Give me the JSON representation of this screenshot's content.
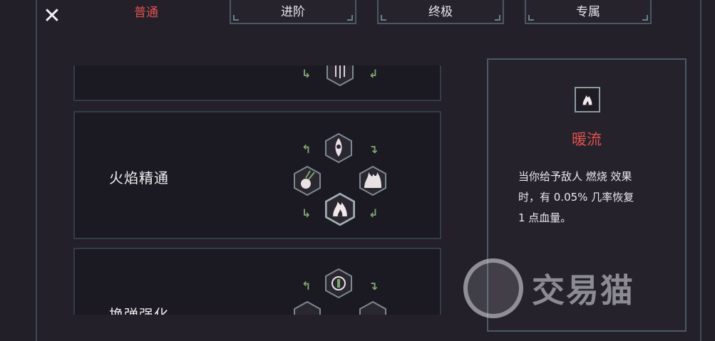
{
  "tabs": [
    {
      "label": "普通",
      "active": true
    },
    {
      "label": "进阶",
      "active": false
    },
    {
      "label": "终极",
      "active": false
    },
    {
      "label": "专属",
      "active": false
    }
  ],
  "skills": [
    {
      "title": "",
      "icons": [
        "arrows-bundle-icon"
      ]
    },
    {
      "title": "火焰精通",
      "icons": [
        "flame-rocket-icon",
        "fire-ball-icon",
        "fire-burst-icon",
        "fire-flame-icon"
      ]
    },
    {
      "title": "换弹强化",
      "icons": [
        "reload-cycle-icon",
        "ammo-icon",
        "ammo-icon"
      ]
    }
  ],
  "detail": {
    "icon": "fire-icon",
    "title": "暖流",
    "description_lines": [
      "当你给予敌人 燃烧 效果",
      "时，有 0.05% 几率恢复",
      "1 点血量。"
    ]
  },
  "watermark": {
    "text": "交易猫"
  },
  "colors": {
    "background": "#221f29",
    "card": "#1b1921",
    "accent_red": "#e0524e",
    "arrow_green": "#7fa56f",
    "border": "#3d4a55"
  }
}
